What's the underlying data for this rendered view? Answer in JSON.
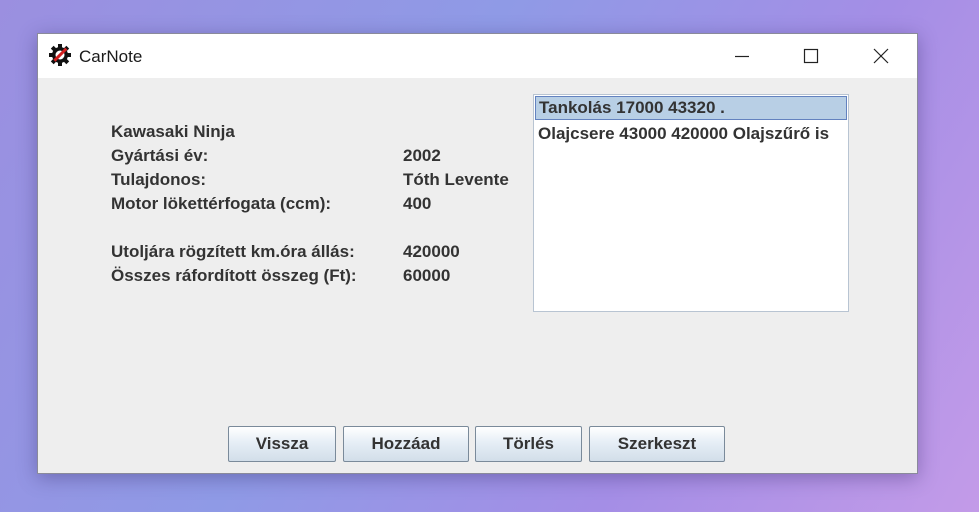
{
  "window": {
    "title": "CarNote",
    "minimize_icon": "minimize-icon",
    "maximize_icon": "maximize-icon",
    "close_icon": "close-icon",
    "app_icon": "gear-wrench-icon"
  },
  "vehicle": {
    "name": "Kawasaki Ninja",
    "year_label": "Gyártási év:",
    "year_value": "2002",
    "owner_label": "Tulajdonos:",
    "owner_value": "Tóth Levente",
    "engine_label": "Motor lökettérfogata (ccm):",
    "engine_value": "400",
    "odometer_label": "Utoljára rögzített km.óra állás:",
    "odometer_value": "420000",
    "total_label": "Összes ráfordított összeg (Ft):",
    "total_value": "60000"
  },
  "records": [
    {
      "text": "Tankolás 17000 43320 .",
      "selected": true
    },
    {
      "text": "Olajcsere 43000 420000 Olajszűrő is",
      "selected": false
    }
  ],
  "buttons": {
    "back": "Vissza",
    "add": "Hozzáad",
    "delete": "Törlés",
    "edit": "Szerkeszt"
  },
  "colors": {
    "window_bg": "#eeeeee",
    "selection_bg": "#b8cfe5",
    "selection_border": "#6382bf"
  }
}
